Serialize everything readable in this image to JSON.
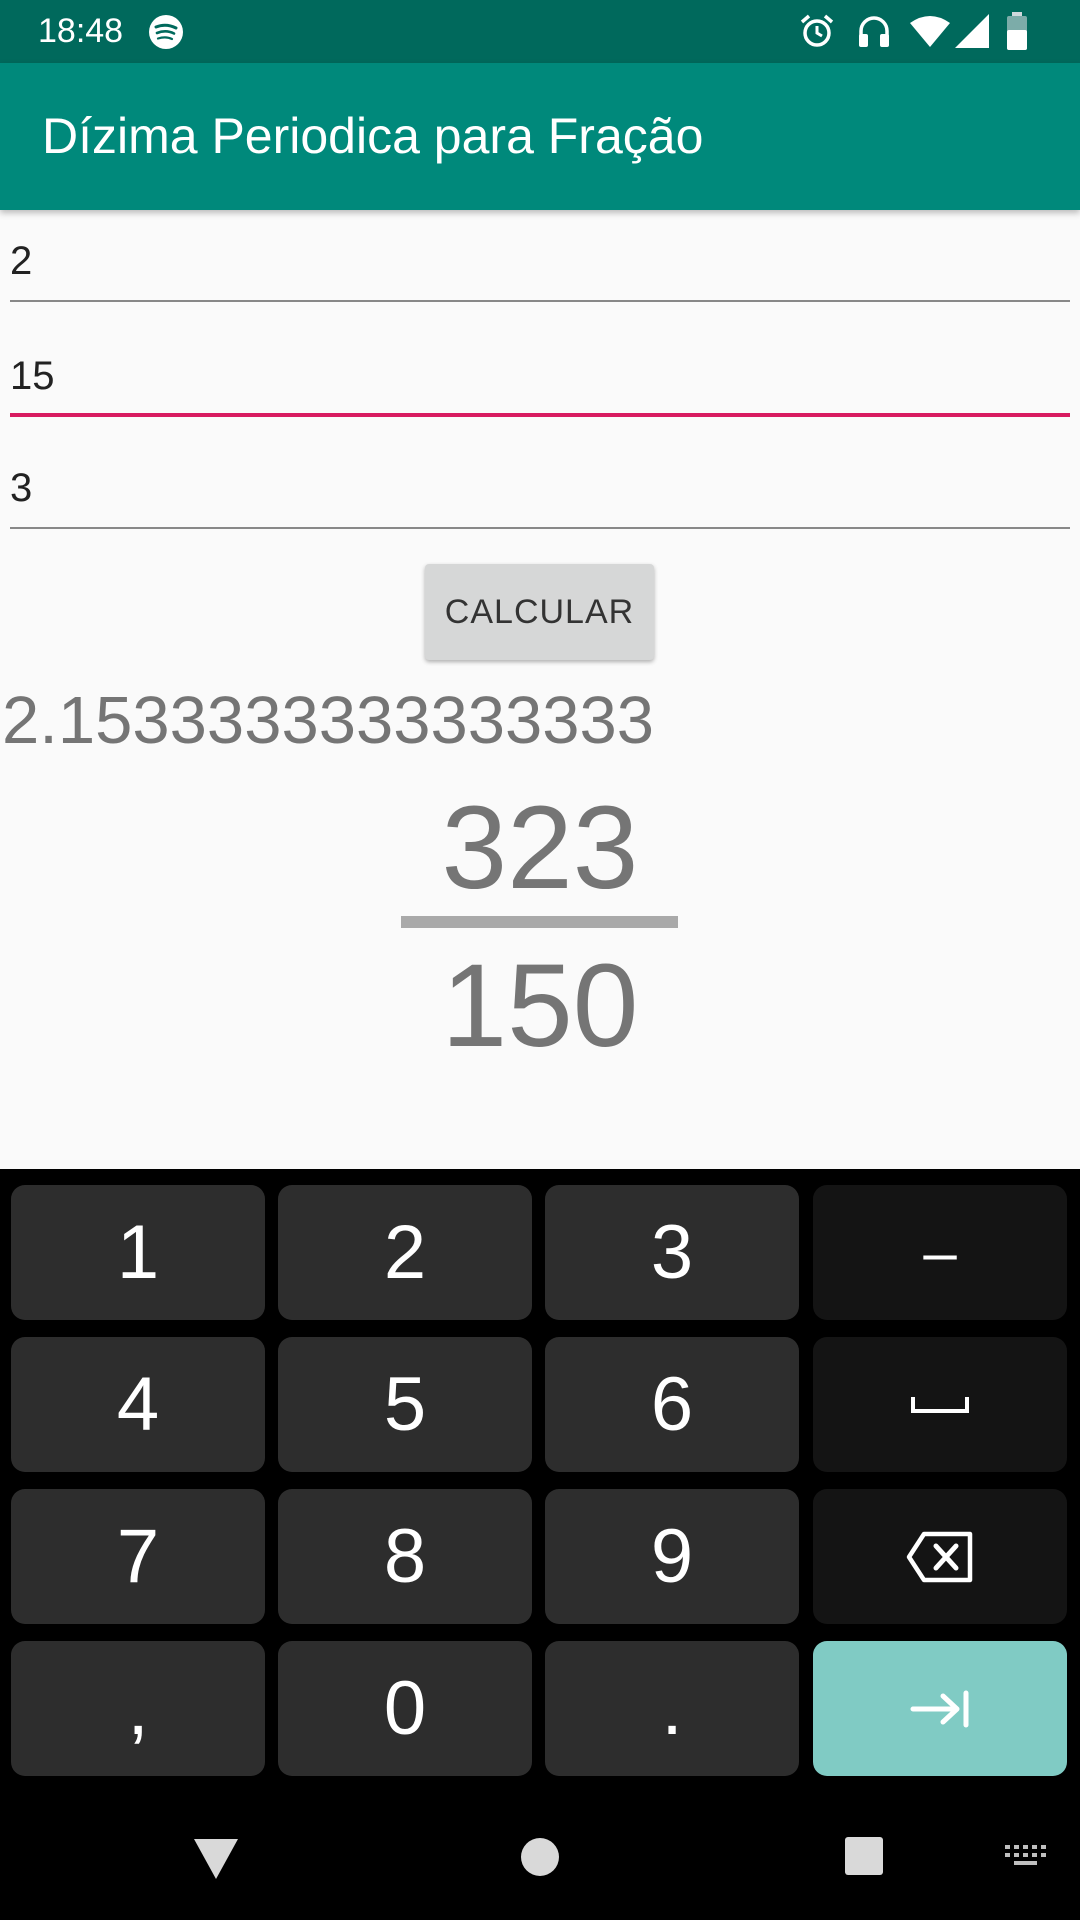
{
  "status_bar": {
    "time": "18:48",
    "icons": [
      "spotify-icon",
      "alarm-icon",
      "headphones-icon",
      "wifi-icon",
      "signal-icon",
      "battery-icon"
    ]
  },
  "app_bar": {
    "title": "Dízima Periodica para Fração"
  },
  "form": {
    "field_integer": "2",
    "field_non_periodic": "15",
    "field_periodic": "3",
    "calculate_label": "CALCULAR"
  },
  "result": {
    "decimal": "2.1533333333333333",
    "numerator": "323",
    "denominator": "150"
  },
  "keyboard": {
    "keys": [
      "1",
      "2",
      "3",
      "–",
      "4",
      "5",
      "6",
      "space",
      "7",
      "8",
      "9",
      "backspace",
      ",",
      "0",
      ".",
      "tab"
    ],
    "colors": {
      "key": "#2d2d2d",
      "function_key": "#141414",
      "enter_key": "#80cbc4"
    }
  },
  "nav_bar": {
    "icons": [
      "back-icon",
      "home-icon",
      "recents-icon",
      "keyboard-switch-icon"
    ]
  },
  "colors": {
    "primary": "#00897b",
    "primary_dark": "#00695c",
    "accent": "#d81b60"
  }
}
